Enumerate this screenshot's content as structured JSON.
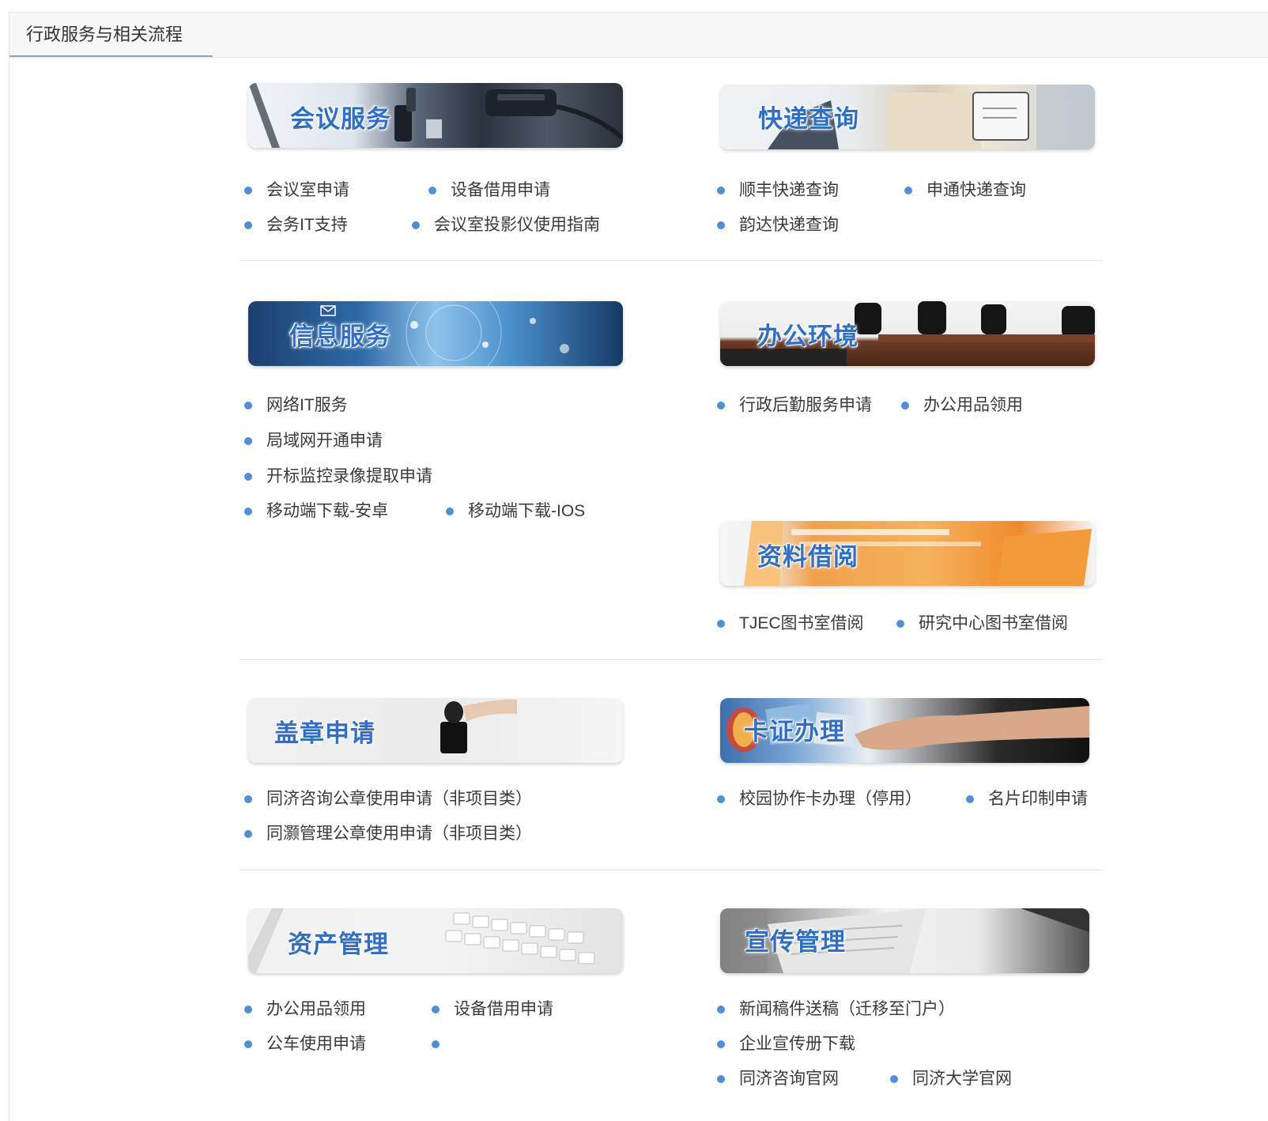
{
  "panel": {
    "title": "行政服务与相关流程"
  },
  "sections": {
    "meeting": {
      "title": "会议服务",
      "links": [
        "会议室申请",
        "设备借用申请",
        "会务IT支持",
        "会议室投影仪使用指南"
      ]
    },
    "express": {
      "title": "快递查询",
      "links": [
        "顺丰快递查询",
        "申通快递查询",
        "韵达快递查询"
      ]
    },
    "info": {
      "title": "信息服务",
      "links": [
        "网络IT服务",
        "局域网开通申请",
        "开标监控录像提取申请",
        "移动端下载-安卓",
        "移动端下载-IOS"
      ]
    },
    "office_env": {
      "title": "办公环境",
      "links": [
        "行政后勤服务申请",
        "办公用品领用"
      ]
    },
    "library": {
      "title": "资料借阅",
      "links": [
        "TJEC图书室借阅",
        "研究中心图书室借阅"
      ]
    },
    "seal": {
      "title": "盖章申请",
      "links": [
        "同济咨询公章使用申请（非项目类）",
        "同灏管理公章使用申请（非项目类）"
      ]
    },
    "card": {
      "title": "卡证办理",
      "links": [
        "校园协作卡办理（停用）",
        "名片印制申请"
      ]
    },
    "asset": {
      "title": "资产管理",
      "links": [
        "办公用品领用",
        "设备借用申请",
        "公车使用申请",
        ""
      ]
    },
    "publicity": {
      "title": "宣传管理",
      "links": [
        "新闻稿件送稿（迁移至门户）",
        "企业宣传册下载",
        "同济咨询官网",
        "同济大学官网"
      ]
    }
  },
  "colors": {
    "accent": "#2f6fc9",
    "bullet": "#4f8fd8",
    "tab_underline": "#8ba4c2"
  }
}
